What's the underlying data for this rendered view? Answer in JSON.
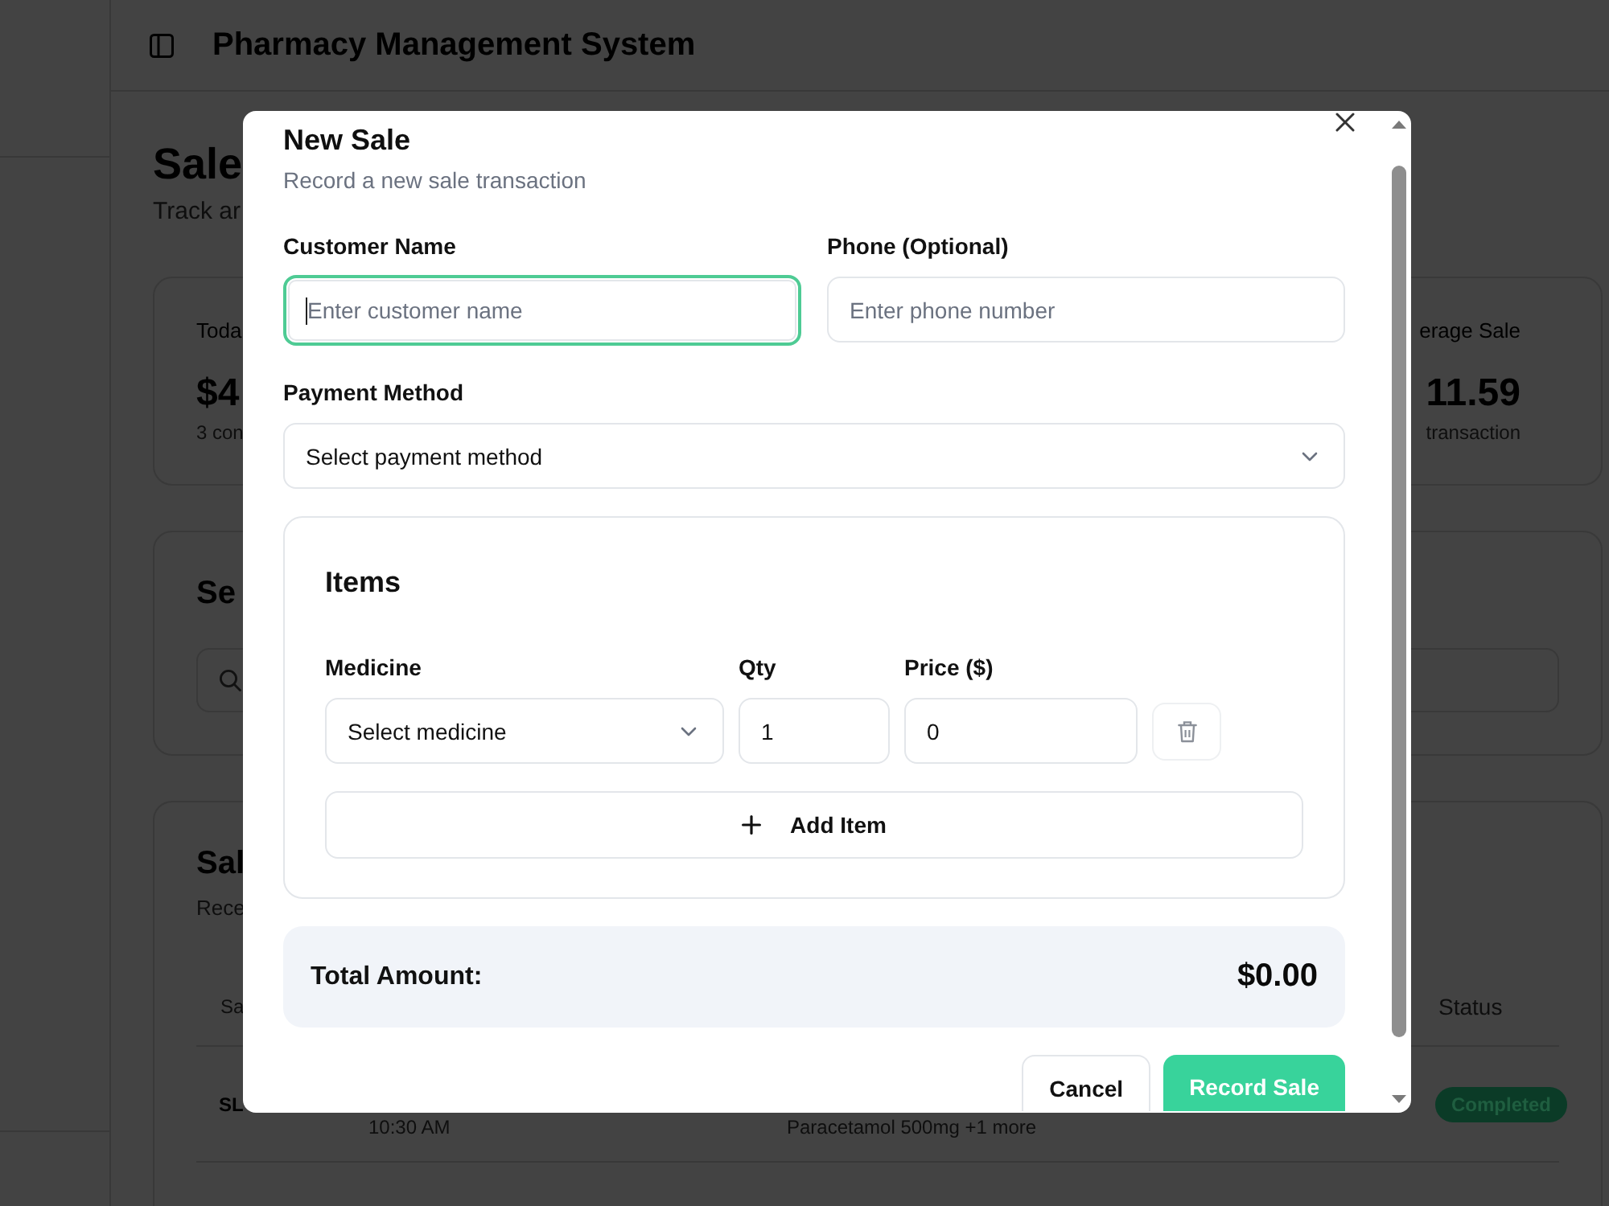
{
  "header": {
    "title": "Pharmacy Management System"
  },
  "page": {
    "title": "Sale",
    "subtitle": "Track ar"
  },
  "stats": [
    {
      "label": "Toda",
      "value": "$4",
      "note": "3 con"
    },
    {
      "label": "erage Sale",
      "value": "11.59",
      "note": "transaction"
    }
  ],
  "search_card": {
    "title": "Se"
  },
  "sales_card": {
    "title": "Sal",
    "subtitle": "Rece",
    "columns": [
      "Sa",
      "Status"
    ],
    "rows": [
      {
        "id": "SL",
        "time": "10:30 AM",
        "items": "Paracetamol 500mg +1 more",
        "status": "Completed"
      }
    ]
  },
  "dialog": {
    "title": "New Sale",
    "subtitle": "Record a new sale transaction",
    "fields": [
      {
        "label": "Customer Name",
        "placeholder": "Enter customer name",
        "focused": true
      },
      {
        "label": "Phone (Optional)",
        "placeholder": "Enter phone number",
        "focused": false
      }
    ],
    "payment": {
      "label": "Payment Method",
      "placeholder": "Select payment method"
    },
    "items": {
      "title": "Items",
      "columns": [
        "Medicine",
        "Qty",
        "Price ($)"
      ],
      "rows": [
        {
          "medicine_placeholder": "Select medicine",
          "qty": "1",
          "price": "0"
        }
      ],
      "add_button": "Add Item"
    },
    "total": {
      "label": "Total Amount:",
      "value": "$0.00"
    },
    "buttons": [
      {
        "label": "Cancel",
        "kind": "secondary"
      },
      {
        "label": "Record Sale",
        "kind": "primary"
      }
    ]
  }
}
